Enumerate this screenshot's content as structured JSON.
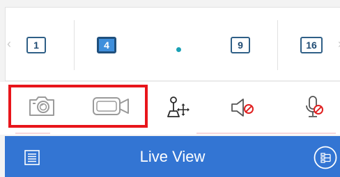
{
  "layout_strip": {
    "left_arrow": "‹",
    "right_arrow": "›",
    "buttons": [
      {
        "label": "1",
        "selected": false
      },
      {
        "label": "4",
        "selected": true
      },
      {
        "label": "9",
        "selected": false
      },
      {
        "label": "16",
        "selected": false
      }
    ]
  },
  "toolbar": {
    "icons": [
      "camera-snapshot-icon",
      "video-record-icon",
      "ptz-joystick-icon",
      "speaker-muted-icon",
      "microphone-off-icon"
    ]
  },
  "bottom_bar": {
    "title": "Live View",
    "color": "#3375d3"
  },
  "colors": {
    "highlight": "#e8151b",
    "selected_layout": "#3f8fdc",
    "page_dot": "#1aa1b5",
    "muted_red": "#e02020"
  }
}
